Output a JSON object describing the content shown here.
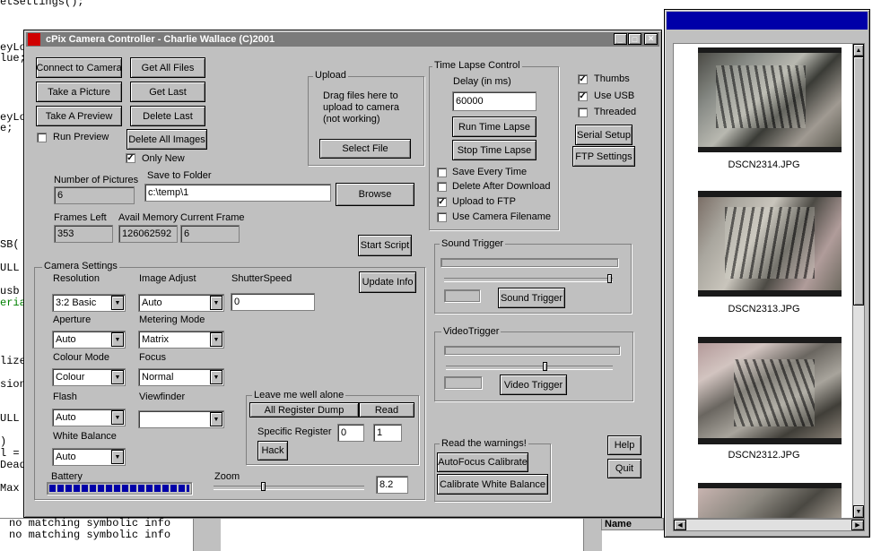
{
  "background_code": {
    "lines": [
      "etSettings();",
      "",
      "eyLo",
      "lue;",
      "eyLo",
      "e;",
      "SB(",
      "ULL",
      "usb",
      "eria",
      "lize",
      "sion",
      "ULL",
      ")",
      "l =",
      "Dead",
      "Max"
    ],
    "output": [
      "no matching symbolic info",
      "no matching symbolic info"
    ],
    "name_header": "Name"
  },
  "window": {
    "title": "cPix Camera Controller - Charlie Wallace (C)2001",
    "controls": {
      "minimize": "_",
      "maximize": "□",
      "close": "×"
    }
  },
  "buttons": {
    "connect": "Connect to Camera",
    "get_all": "Get All Files",
    "take_picture": "Take a Picture",
    "get_last": "Get Last",
    "take_preview": "Take A Preview",
    "delete_last": "Delete Last",
    "delete_all": "Delete All Images",
    "browse": "Browse",
    "start_script": "Start Script",
    "update_info": "Update Info",
    "help": "Help",
    "quit": "Quit"
  },
  "checks": {
    "run_preview": {
      "label": "Run Preview",
      "checked": false
    },
    "only_new": {
      "label": "Only New",
      "checked": true
    }
  },
  "upload": {
    "title": "Upload",
    "text": "Drag files here to upload to camera (not working)",
    "select_file": "Select File"
  },
  "timelapse": {
    "title": "Time Lapse Control",
    "delay_label": "Delay (in ms)",
    "delay_value": "60000",
    "run": "Run Time Lapse",
    "stop": "Stop Time Lapse",
    "options": [
      {
        "label": "Save Every Time",
        "checked": false
      },
      {
        "label": "Delete After Download",
        "checked": false
      },
      {
        "label": "Upload to FTP",
        "checked": true
      },
      {
        "label": "Use Camera Filename",
        "checked": false
      }
    ]
  },
  "right_options": [
    {
      "label": "Thumbs",
      "checked": true
    },
    {
      "label": "Use USB",
      "checked": true
    },
    {
      "label": "Threaded",
      "checked": false
    }
  ],
  "right_buttons": {
    "serial": "Serial Setup",
    "ftp": "FTP Settings"
  },
  "info": {
    "num_pictures_label": "Number of Pictures",
    "num_pictures": "6",
    "save_folder_label": "Save to Folder",
    "save_folder": "c:\\temp\\1",
    "frames_left_label": "Frames Left",
    "frames_left": "353",
    "avail_memory_label": "Avail Memory",
    "avail_memory": "126062592",
    "current_frame_label": "Current Frame",
    "current_frame": "6"
  },
  "camera_settings": {
    "title": "Camera Settings",
    "resolution": {
      "label": "Resolution",
      "value": "3:2 Basic"
    },
    "image_adjust": {
      "label": "Image Adjust",
      "value": "Auto"
    },
    "shutter_speed": {
      "label": "ShutterSpeed",
      "value": "0"
    },
    "aperture": {
      "label": "Aperture",
      "value": "Auto"
    },
    "metering": {
      "label": "Metering Mode",
      "value": "Matrix"
    },
    "colour_mode": {
      "label": "Colour Mode",
      "value": "Colour"
    },
    "focus": {
      "label": "Focus",
      "value": "Normal"
    },
    "flash": {
      "label": "Flash",
      "value": "Auto"
    },
    "viewfinder": {
      "label": "Viewfinder",
      "value": ""
    },
    "white_balance": {
      "label": "White Balance",
      "value": "Auto"
    },
    "battery_label": "Battery",
    "battery_level": 1.0,
    "zoom_label": "Zoom",
    "zoom_value": "8.2",
    "zoom_fraction": 0.33
  },
  "register": {
    "title": "Leave me well alone",
    "dump": "All Register Dump",
    "read": "Read",
    "specific_label": "Specific Register",
    "reg_value": "0",
    "reg_value2": "1",
    "hack": "Hack"
  },
  "sound_trigger": {
    "title": "Sound Trigger",
    "button": "Sound Trigger",
    "slider_fraction": 1.0
  },
  "video_trigger": {
    "title": "VideoTrigger",
    "button": "Video Trigger",
    "slider_fraction": 0.6
  },
  "warnings": {
    "title": "Read the warnings!",
    "autofocus": "AutoFocus Calibrate",
    "white_balance": "Calibrate White Balance"
  },
  "thumbs": [
    "DSCN2314.JPG",
    "DSCN2313.JPG",
    "DSCN2312.JPG"
  ],
  "colors": {
    "titlebar": "#7b7b7b",
    "thumb_titlebar": "#0000a8",
    "battery": "#0000a8",
    "face": "#c0c0c0"
  }
}
